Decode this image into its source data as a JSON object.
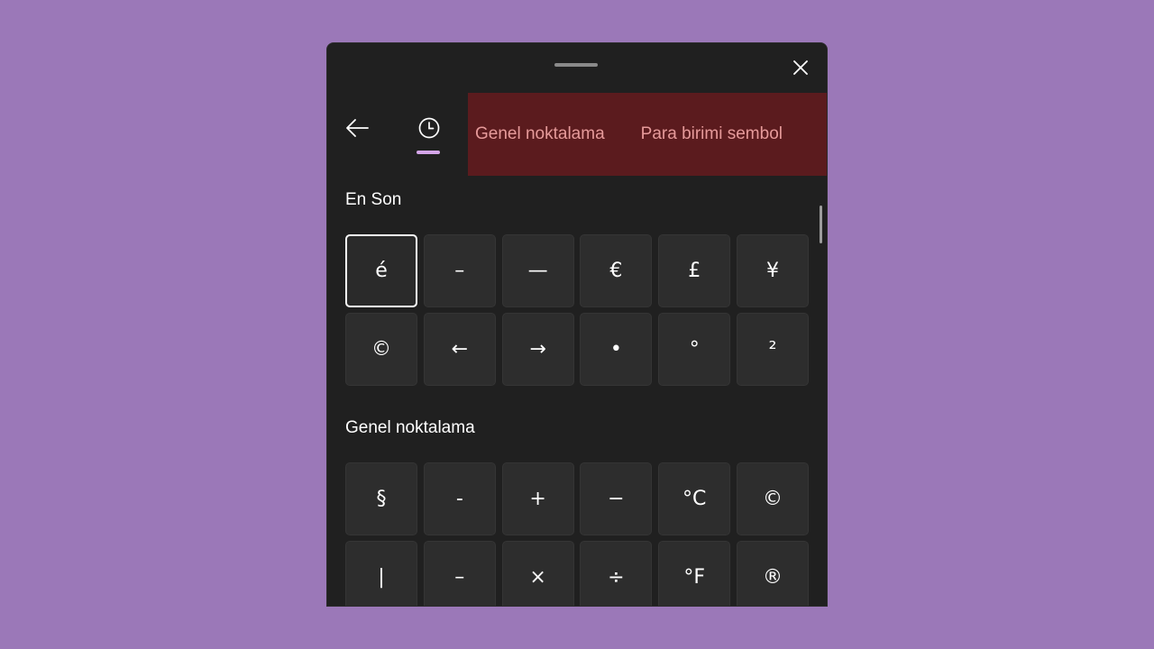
{
  "panel": {
    "tabs": [
      "Genel noktalama",
      "Para birimi sembol"
    ],
    "icons": {
      "close": "close-icon",
      "back": "back-arrow-icon",
      "recent": "clock-icon"
    },
    "colors": {
      "accent": "#d4a5e8",
      "tab_bg": "#5b1b1e",
      "tab_text": "#e69a9a"
    }
  },
  "sections": [
    {
      "title": "En Son",
      "keys": [
        "é",
        "–",
        "—",
        "€",
        "£",
        "¥",
        "©",
        "←",
        "→",
        "•",
        "°",
        "²"
      ]
    },
    {
      "title": "Genel noktalama",
      "keys": [
        "§",
        "-",
        "+",
        "−",
        "°C",
        "©",
        "|",
        "–",
        "×",
        "÷",
        "°F",
        "®"
      ]
    }
  ]
}
